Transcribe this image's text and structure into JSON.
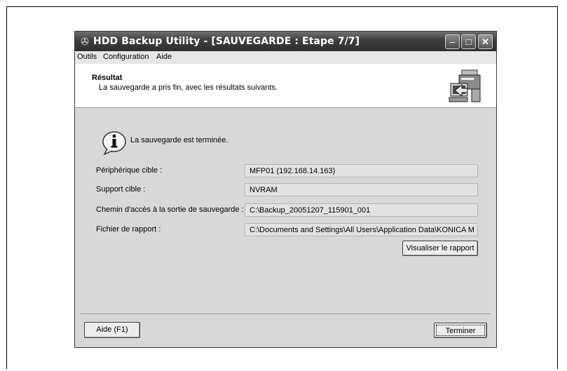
{
  "window": {
    "title": "HDD Backup Utility - [SAUVEGARDE : Etape 7/7]",
    "buttons": {
      "minimize": "–",
      "maximize": "□",
      "close": "✕"
    }
  },
  "menu": [
    "Outils",
    "Configuration",
    "Aide"
  ],
  "header": {
    "title": "Résultat",
    "subtitle": "La sauvegarde a pris fin, avec les résultats suivants.",
    "icon": "printer-computer-icon"
  },
  "status": {
    "icon": "info-icon",
    "text": "La sauvegarde est terminée."
  },
  "fields": [
    {
      "label": "Périphérique cible :",
      "value": "MFP01  (192.168.14.163)"
    },
    {
      "label": "Support cible :",
      "value": "NVRAM"
    },
    {
      "label": "Chemin d'accès à la sortie de sauvegarde :",
      "value": "C:\\Backup_20051207_115901_001"
    },
    {
      "label": "Fichier de rapport :",
      "value": "C:\\Documents and Settings\\All Users\\Application Data\\KONICA M"
    }
  ],
  "buttons": {
    "view_report": "Visualiser le rapport",
    "help": "Aide (F1)",
    "finish": "Terminer"
  }
}
